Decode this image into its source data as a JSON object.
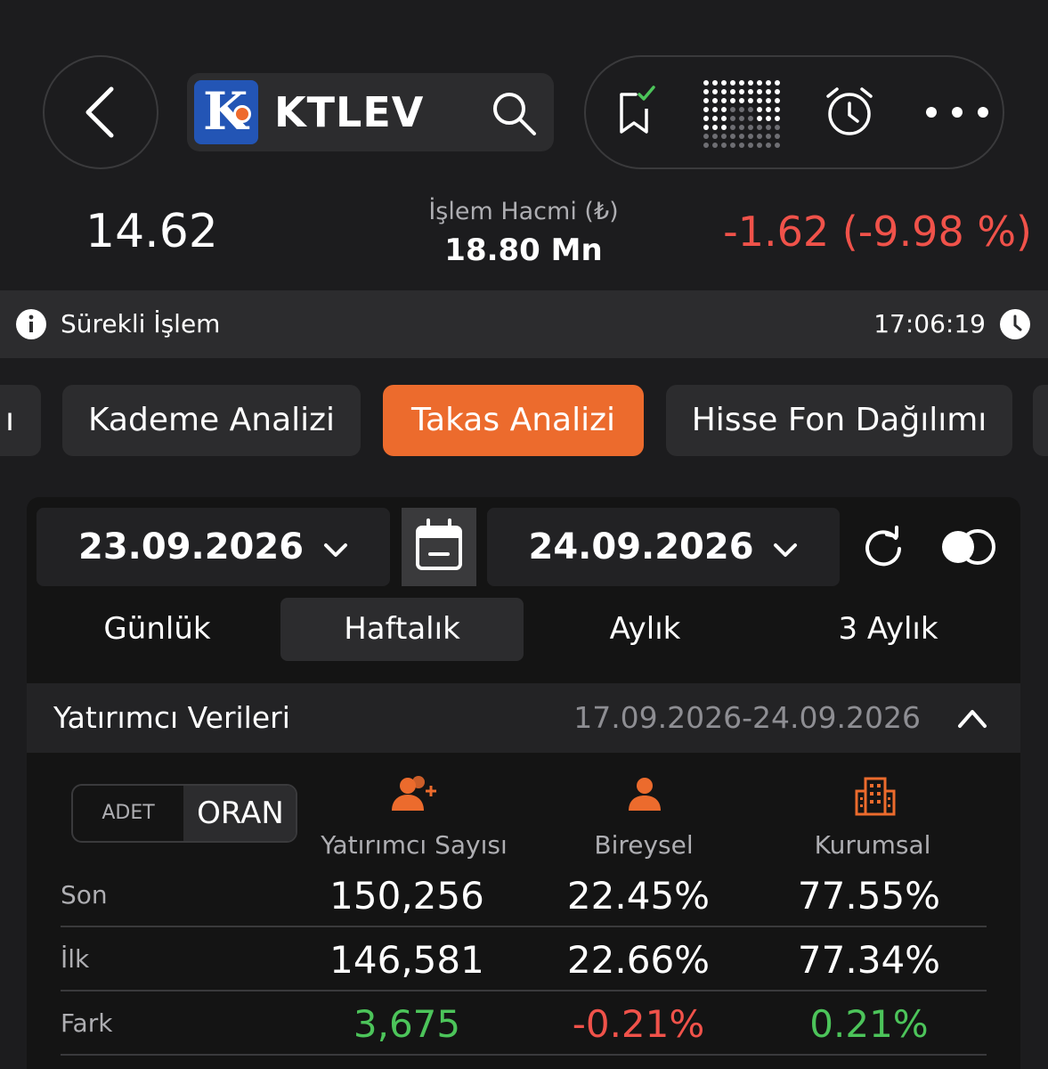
{
  "header": {
    "symbol": "KTLEV",
    "logo_letter": "K"
  },
  "quote": {
    "price": "14.62",
    "volume_label": "İşlem Hacmi (₺)",
    "volume_value": "18.80 Mn",
    "change": "-1.62 (-9.98 %)"
  },
  "status": {
    "label": "Sürekli İşlem",
    "time": "17:06:19"
  },
  "tabs": [
    {
      "label": "ı"
    },
    {
      "label": "Kademe Analizi"
    },
    {
      "label": "Takas Analizi"
    },
    {
      "label": "Hisse Fon Dağılımı"
    }
  ],
  "dates": {
    "start": "23.09.2026",
    "end": "24.09.2026"
  },
  "periods": [
    "Günlük",
    "Haftalık",
    "Aylık",
    "3 Aylık"
  ],
  "section": {
    "title": "Yatırımcı Verileri",
    "range": "17.09.2026-24.09.2026"
  },
  "toggle": {
    "adet": "ADET",
    "oran": "ORAN"
  },
  "columns": [
    "Yatırımcı Sayısı",
    "Bireysel",
    "Kurumsal"
  ],
  "rows": [
    {
      "label": "Son",
      "values": [
        "150,256",
        "22.45%",
        "77.55%"
      ]
    },
    {
      "label": "İlk",
      "values": [
        "146,581",
        "22.66%",
        "77.34%"
      ]
    },
    {
      "label": "Fark",
      "values": [
        "3,675",
        "-0.21%",
        "0.21%"
      ]
    }
  ],
  "colors": {
    "accent": "#ec6b2d",
    "negative": "#f0524a",
    "positive": "#4cc45a",
    "logo_blue": "#2355b5"
  }
}
